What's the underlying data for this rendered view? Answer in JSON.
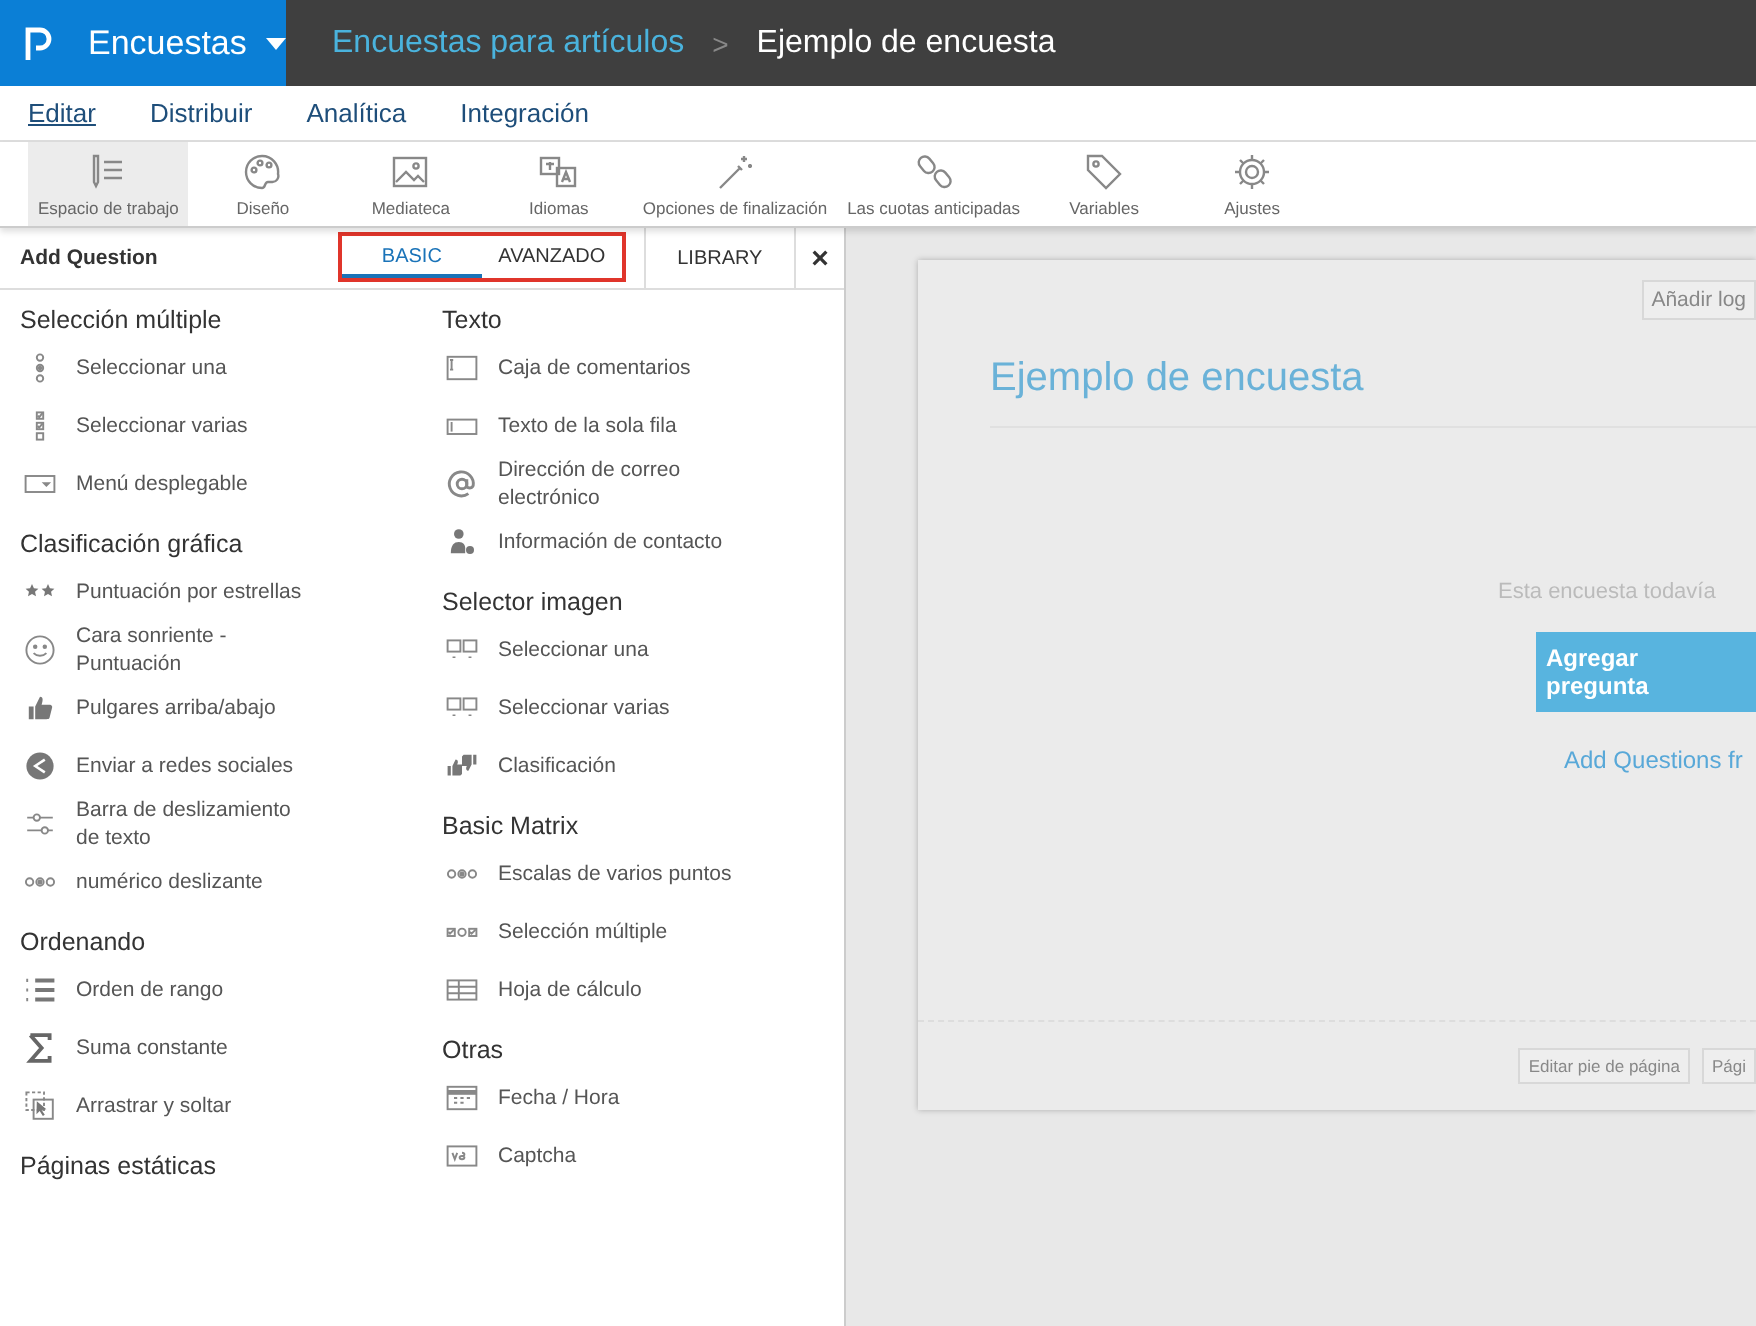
{
  "app_bar": {
    "product": "Encuestas",
    "breadcrumb": [
      "Encuestas para artículos",
      "Ejemplo de encuesta"
    ],
    "separator": ">"
  },
  "menu": [
    {
      "label": "Editar",
      "selected": true
    },
    {
      "label": "Distribuir",
      "selected": false
    },
    {
      "label": "Analítica",
      "selected": false
    },
    {
      "label": "Integración",
      "selected": false
    }
  ],
  "toolbar": [
    {
      "label": "Espacio de trabajo",
      "selected": true
    },
    {
      "label": "Diseño",
      "selected": false
    },
    {
      "label": "Mediateca",
      "selected": false
    },
    {
      "label": "Idiomas",
      "selected": false
    },
    {
      "label": "Opciones de finalización",
      "selected": false
    },
    {
      "label": "Las cuotas anticipadas",
      "selected": false
    },
    {
      "label": "Variables",
      "selected": false
    },
    {
      "label": "Ajustes",
      "selected": false
    }
  ],
  "panel": {
    "title": "Add Question",
    "close": "×",
    "tabs": [
      {
        "label": "BASIC",
        "selected": true,
        "highlighted": true
      },
      {
        "label": "AVANZADO",
        "selected": false,
        "highlighted": true
      },
      {
        "label": "LIBRARY",
        "selected": false,
        "highlighted": false
      }
    ],
    "columns": [
      [
        {
          "heading": "Selección múltiple",
          "items": [
            "Seleccionar una",
            "Seleccionar varias",
            "Menú desplegable"
          ]
        },
        {
          "heading": "Clasificación gráfica",
          "items": [
            "Puntuación por estrellas",
            "Cara sonriente - Puntuación",
            "Pulgares arriba/abajo",
            "Enviar a redes sociales",
            "Barra de deslizamiento de texto",
            "numérico deslizante"
          ]
        },
        {
          "heading": "Ordenando",
          "items": [
            "Orden de rango",
            "Suma constante",
            "Arrastrar y soltar"
          ]
        },
        {
          "heading": "Páginas estáticas"
        }
      ],
      [
        {
          "heading": "Texto",
          "items": [
            "Caja de comentarios",
            "Texto de la sola fila",
            "Dirección de correo electrónico",
            "Información de contacto"
          ]
        },
        {
          "heading": "Selector imagen",
          "items": [
            "Seleccionar una",
            "Seleccionar varias",
            "Clasificación"
          ]
        },
        {
          "heading": "Basic Matrix",
          "items": [
            "Escalas de varios puntos",
            "Selección múltiple",
            "Hoja de cálculo"
          ]
        },
        {
          "heading": "Otras",
          "items": [
            "Fecha / Hora",
            "Captcha"
          ]
        }
      ]
    ]
  },
  "survey": {
    "logo_button": "Añadir log",
    "title": "Ejemplo de encuesta",
    "empty_message": "Esta encuesta todavía",
    "add_button": "Agregar pregunta",
    "library_link": "Add Questions fr",
    "footer_buttons": [
      "Editar pie de página",
      "Pági"
    ]
  }
}
